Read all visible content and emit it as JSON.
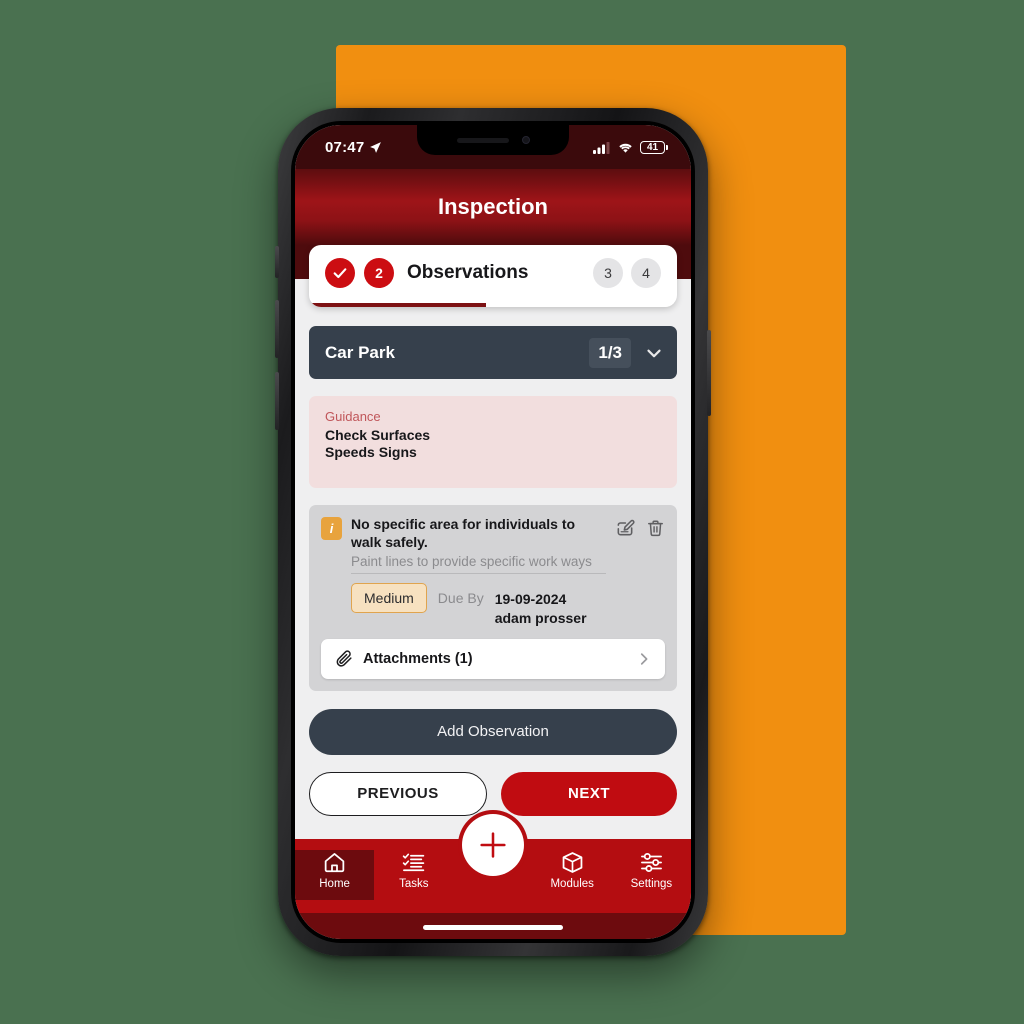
{
  "colors": {
    "page_background": "#4a7150",
    "accent_panel": "#f18f10",
    "brand_red": "#b40d11",
    "header_red": "#9e1418",
    "dark_slate": "#36404c",
    "guidance_pink": "#f2dede",
    "severity_orange": "#e0a44e",
    "card_gray": "#d3d3d5"
  },
  "status_bar": {
    "time": "07:47",
    "location_icon": "location-arrow-icon",
    "signal_icon": "cellular-signal-icon",
    "wifi_icon": "wifi-icon",
    "battery_level": "41"
  },
  "header": {
    "title": "Inspection"
  },
  "stepper": {
    "steps": [
      {
        "label": "",
        "state": "done",
        "icon": "check-icon"
      },
      {
        "label": "2",
        "state": "active"
      },
      {
        "label": "3",
        "state": "idle"
      },
      {
        "label": "4",
        "state": "idle"
      }
    ],
    "current_label": "Observations",
    "progress_percent": 48
  },
  "section": {
    "name": "Car Park",
    "count": "1/3",
    "chevron_icon": "chevron-down-icon"
  },
  "guidance": {
    "title": "Guidance",
    "lines": [
      "Check Surfaces",
      "Speeds Signs"
    ]
  },
  "observation": {
    "info_icon": "info-icon",
    "info_glyph": "i",
    "title": "No specific area for individuals to walk safely.",
    "subtitle": "Paint lines to provide specific work ways",
    "edit_icon": "edit-icon",
    "delete_icon": "trash-icon",
    "severity": "Medium",
    "due_label": "Due By",
    "due_date": "19-09-2024",
    "assignee": "adam prosser",
    "attachments": {
      "icon": "paperclip-icon",
      "label": "Attachments (1)",
      "chevron_icon": "chevron-right-icon"
    }
  },
  "actions": {
    "add_observation": "Add Observation",
    "previous": "PREVIOUS",
    "next": "NEXT"
  },
  "side_tab": {
    "icon": "drag-handle-icon"
  },
  "bottom_nav": {
    "items": [
      {
        "label": "Home",
        "icon": "home-icon",
        "active": true
      },
      {
        "label": "Tasks",
        "icon": "checklist-icon",
        "active": false
      },
      {
        "label": "Modules",
        "icon": "box-icon",
        "active": false
      },
      {
        "label": "Settings",
        "icon": "sliders-icon",
        "active": false
      }
    ],
    "fab_icon": "plus-icon"
  }
}
